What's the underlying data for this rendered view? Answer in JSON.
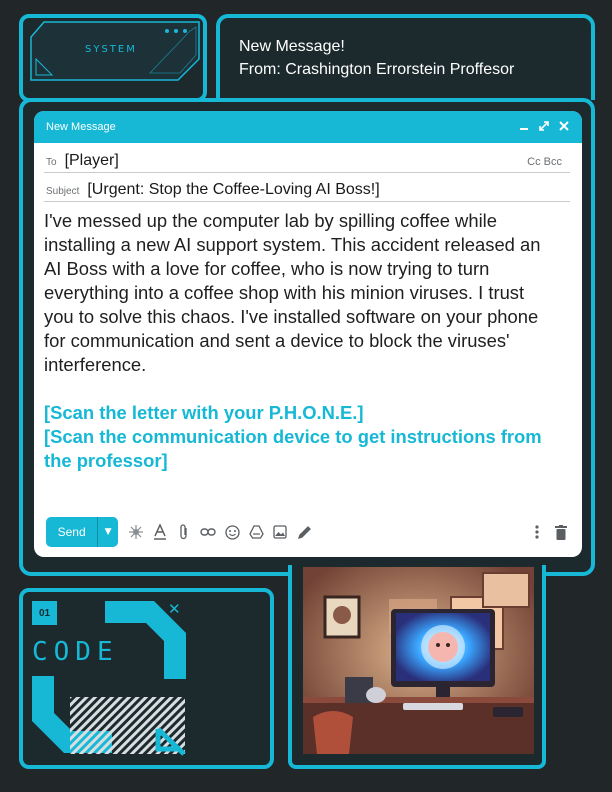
{
  "system_panel": {
    "label": "SYSTEM",
    "dots_icon": "three-dots-icon"
  },
  "header": {
    "line1": "New Message!",
    "line2": "From: Crashington Errorstein Proffesor"
  },
  "email": {
    "window_title": "New Message",
    "controls": {
      "minimize": "minimize-icon",
      "expand": "expand-icon",
      "close": "close-icon"
    },
    "to_label": "To",
    "to_value": "[Player]",
    "cc_bcc": "Cc Bcc",
    "subject_label": "Subject",
    "subject_value": "[Urgent: Stop the Coffee-Loving AI Boss!]",
    "body_lines": [
      "I've messed up the computer lab by spilling coffee while",
      "installing a new AI support system. This accident released an",
      "AI Boss with a love for coffee, who is now trying to turn",
      "everything into a coffee shop with his minion viruses. I trust",
      "you to solve this chaos. I've installed software on your phone",
      "for communication and sent a device to block the viruses'",
      "interference."
    ],
    "scan_lines": [
      "[Scan the letter with your P.H.O.N.E.]",
      "[Scan the communication device to get instructions from",
      "the professor]"
    ],
    "toolbar": {
      "send_label": "Send",
      "icons": [
        "send-options-icon",
        "ai-sparkle-icon",
        "text-format-icon",
        "attach-icon",
        "link-icon",
        "emoji-icon",
        "drive-icon",
        "image-icon",
        "signature-icon",
        "more-options-icon",
        "trash-icon"
      ]
    }
  },
  "code_panel": {
    "label": "CODE",
    "badge": "01",
    "close_icon": "close-icon"
  },
  "image_panel": {
    "alt": "computer-lab-illustration"
  },
  "colors": {
    "accent": "#16b8d6",
    "background": "#212628",
    "panel": "#1c2a2d"
  }
}
